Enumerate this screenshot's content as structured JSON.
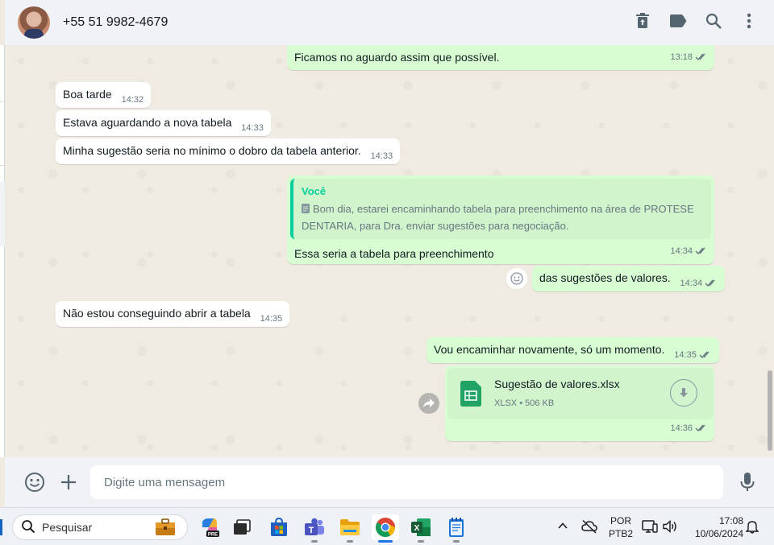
{
  "header": {
    "contact_name": "+55 51 9982-4679",
    "icons": [
      "delete-icon",
      "label-icon",
      "search-icon",
      "menu-icon"
    ]
  },
  "messages": [
    {
      "dir": "out",
      "text": "Ficamos no aguardo assim que possível.",
      "time": "13:18",
      "status": "read"
    },
    {
      "dir": "in",
      "text": "Boa tarde",
      "time": "14:32"
    },
    {
      "dir": "in",
      "text": "Estava aguardando a nova tabela",
      "time": "14:33"
    },
    {
      "dir": "in",
      "text": "Minha sugestão seria no mínimo o dobro da tabela anterior.",
      "time": "14:33"
    },
    {
      "dir": "out",
      "quote_author": "Você",
      "quote_text": "Bom dia, estarei encaminhando tabela para preenchimento na área de PROTESE DENTARIA, para Dra. enviar sugestões para negociação.",
      "text": "Essa seria a tabela para preenchimento",
      "time": "14:34",
      "status": "read"
    },
    {
      "dir": "out",
      "text": "das sugestões de valores.",
      "time": "14:34",
      "status": "read"
    },
    {
      "dir": "in",
      "text": "Não estou conseguindo abrir a tabela",
      "time": "14:35"
    },
    {
      "dir": "out",
      "text": "Vou encaminhar novamente, só um momento.",
      "time": "14:35",
      "status": "read"
    },
    {
      "dir": "out",
      "file_name": "Sugestão de valores.xlsx",
      "file_type": "XLSX",
      "file_size": "506 KB",
      "time": "14:36",
      "status": "read"
    }
  ],
  "composer": {
    "placeholder": "Digite uma mensagem"
  },
  "taskbar": {
    "search_label": "Pesquisar",
    "lang_top": "POR",
    "lang_bottom": "PTB2",
    "time": "17:08",
    "date": "10/06/2024"
  },
  "colors": {
    "outgoing_bubble": "#d9fdd3",
    "incoming_bubble": "#ffffff",
    "quote_accent": "#06cf9c",
    "read_ticks": "#667781",
    "header_bg": "#f0f2f5"
  }
}
